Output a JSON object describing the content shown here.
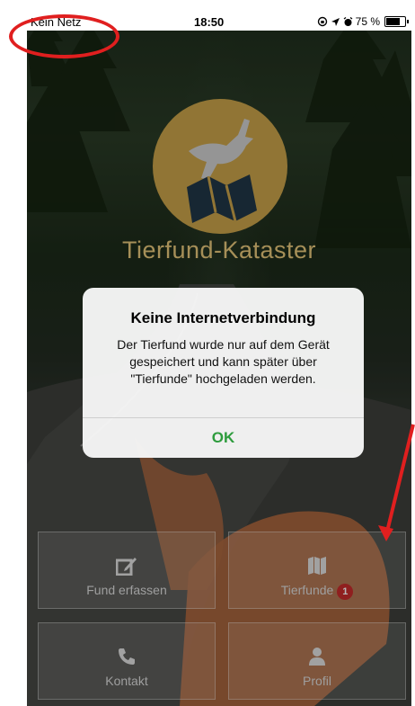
{
  "status_bar": {
    "carrier": "Kein Netz",
    "time": "18:50",
    "battery_text": "75 %",
    "battery_level": 0.75,
    "icons": [
      "orientation-lock-icon",
      "location-arrow-icon",
      "alarm-icon",
      "battery-icon"
    ]
  },
  "app": {
    "title": "Tierfund-Kataster",
    "logo_icon": "deer-map-logo-icon",
    "accent": "#c9a24a"
  },
  "alert": {
    "title": "Keine Internetverbindung",
    "message": "Der Tierfund wurde nur auf dem Gerät gespeichert und kann später über \"Tierfunde\" hochgeladen werden.",
    "ok_label": "OK",
    "ok_color": "#2e9c3d"
  },
  "tiles": {
    "fund_erfassen": {
      "label": "Fund erfassen",
      "icon": "edit-icon"
    },
    "tierfunde": {
      "label": "Tierfunde",
      "icon": "map-icon",
      "badge": "1",
      "badge_color": "#c62b2b"
    },
    "kontakt": {
      "label": "Kontakt",
      "icon": "phone-icon"
    },
    "profil": {
      "label": "Profil",
      "icon": "user-icon"
    }
  },
  "annotation_color": "#e01f1f"
}
